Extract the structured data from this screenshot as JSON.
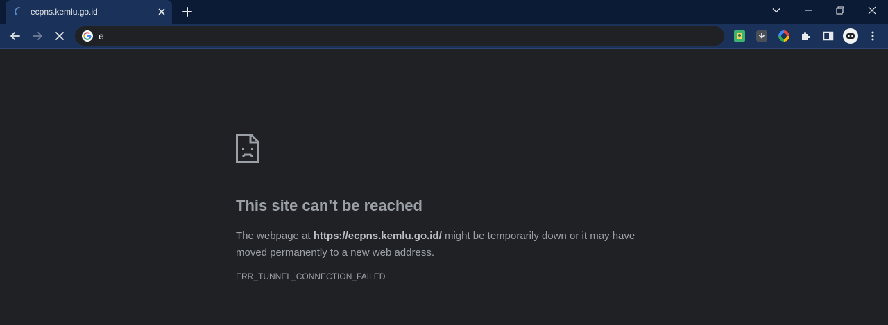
{
  "tab": {
    "title": "ecpns.kemlu.go.id",
    "loading": true
  },
  "omnibox": {
    "value": "e",
    "icon": "google-g-icon"
  },
  "toolbar": {
    "icons": [
      "back-arrow-icon",
      "forward-arrow-icon",
      "stop-loading-icon"
    ],
    "extensions": [
      "extension-green-icon",
      "extension-download-icon",
      "extension-color-wheel-icon",
      "extensions-puzzle-icon",
      "side-panel-icon",
      "profile-avatar-icon",
      "more-menu-icon"
    ]
  },
  "window_controls": [
    "tab-search-chevron-icon",
    "minimize-icon",
    "restore-icon",
    "close-window-icon"
  ],
  "error_page": {
    "icon": "sad-page-icon",
    "title": "This site can’t be reached",
    "desc_prefix": "The webpage at ",
    "url": "https://ecpns.kemlu.go.id/",
    "desc_suffix": " might be temporarily down or it may have moved permanently to a new web address.",
    "error_code": "ERR_TUNNEL_CONNECTION_FAILED"
  },
  "colors": {
    "titlebar_bg": "#0b1b36",
    "toolbar_bg": "#1a3259",
    "page_bg": "#202124",
    "omnibox_bg": "#202124",
    "text_muted": "#9aa0a6",
    "spinner_blue": "#8ab4f8"
  }
}
